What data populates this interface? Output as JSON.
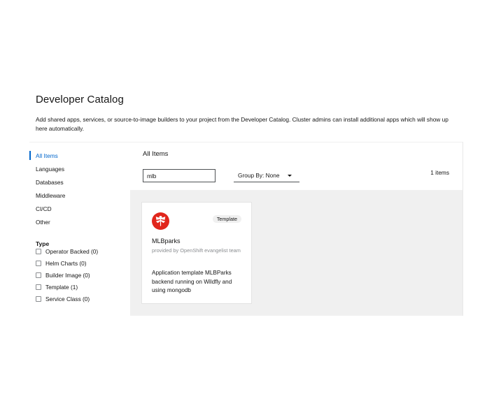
{
  "page": {
    "title": "Developer Catalog",
    "description": "Add shared apps, services, or source-to-image builders to your project from the Developer Catalog. Cluster admins can install additional apps which will show up here automatically."
  },
  "sidebar": {
    "categories": [
      {
        "label": "All Items",
        "active": true
      },
      {
        "label": "Languages",
        "active": false
      },
      {
        "label": "Databases",
        "active": false
      },
      {
        "label": "Middleware",
        "active": false
      },
      {
        "label": "CI/CD",
        "active": false
      },
      {
        "label": "Other",
        "active": false
      }
    ],
    "type_heading": "Type",
    "type_filters": [
      {
        "label": "Operator Backed (0)",
        "checked": false
      },
      {
        "label": "Helm Charts (0)",
        "checked": false
      },
      {
        "label": "Builder Image (0)",
        "checked": false
      },
      {
        "label": "Template (1)",
        "checked": false
      },
      {
        "label": "Service Class (0)",
        "checked": false
      }
    ]
  },
  "main": {
    "title": "All Items",
    "search": {
      "value": "mlb",
      "placeholder": ""
    },
    "group_by_label": "Group By: None",
    "item_count": "1 items"
  },
  "cards": [
    {
      "icon": "dragonfly-icon",
      "badge": "Template",
      "title": "MLBparks",
      "provider": "provided by OpenShift evangelist team",
      "description": "Application template MLBParks backend running on Wildfly and using mongodb"
    }
  ],
  "colors": {
    "accent": "#0066cc",
    "icon_bg": "#e1261c",
    "grid_bg": "#f0f0f0"
  }
}
